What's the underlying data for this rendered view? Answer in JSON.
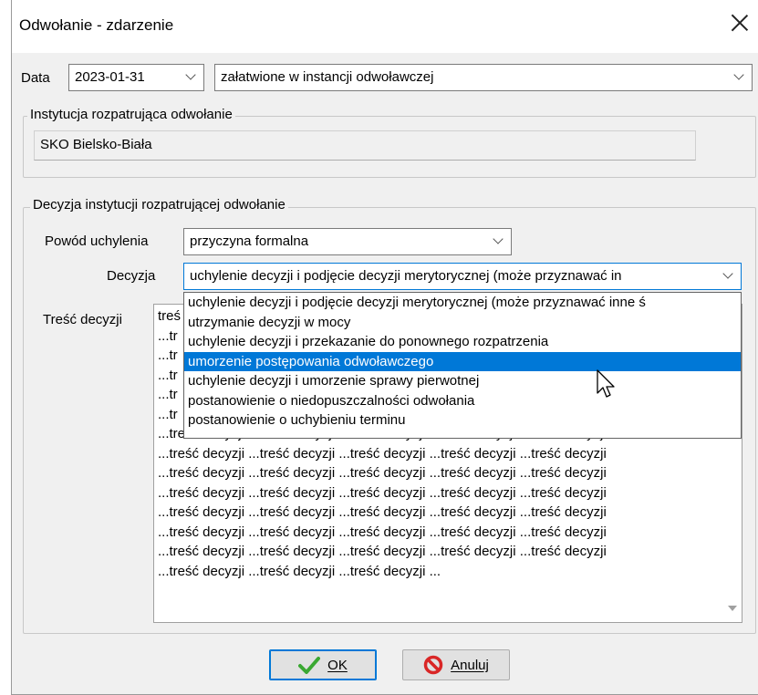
{
  "window": {
    "title": "Odwołanie - zdarzenie"
  },
  "data_row": {
    "label": "Data",
    "date_value": "2023-01-31",
    "status_value": "załatwione w instancji odwoławczej"
  },
  "institution": {
    "legend": "Instytucja rozpatrująca odwołanie",
    "value": "SKO Bielsko-Biała"
  },
  "decision_group": {
    "legend": "Decyzja instytucji rozpatrującej odwołanie",
    "reason_label": "Powód uchylenia",
    "reason_value": "przyczyna formalna",
    "decision_label": "Decyzja",
    "decision_value": "uchylenie decyzji i podjęcie decyzji merytorycznej (może przyznawać in",
    "content_label": "Treść decyzji",
    "content_lines": [
      "treś",
      "...tr",
      "...tr",
      "...tr",
      "...tr",
      "...tr",
      "...treść decyzji ...treść decyzji ...treść decyzji ...treść decyzji ...treść decyzji",
      "...treść decyzji ...treść decyzji ...treść decyzji ...treść decyzji ...treść decyzji",
      "...treść decyzji ...treść decyzji ...treść decyzji ...treść decyzji ...treść decyzji",
      "...treść decyzji ...treść decyzji ...treść decyzji ...treść decyzji ...treść decyzji",
      "...treść decyzji ...treść decyzji ...treść decyzji ...treść decyzji ...treść decyzji",
      "...treść decyzji ...treść decyzji ...treść decyzji ...treść decyzji ...treść decyzji",
      "...treść decyzji ...treść decyzji ...treść decyzji ...treść decyzji ...treść decyzji",
      "...treść decyzji ...treść decyzji ...treść decyzji ..."
    ]
  },
  "decision_dropdown": {
    "options": [
      "uchylenie decyzji i podjęcie decyzji merytorycznej (może przyznawać inne ś",
      "utrzymanie decyzji w mocy",
      "uchylenie decyzji i przekazanie do ponownego rozpatrzenia",
      "umorzenie postępowania odwoławczego",
      "uchylenie decyzji i umorzenie sprawy pierwotnej",
      "postanowienie o niedopuszczalności odwołania",
      "postanowienie o uchybieniu terminu"
    ],
    "highlighted_index": 3
  },
  "buttons": {
    "ok_label": "OK",
    "cancel_label": "Anuluj"
  },
  "colors": {
    "selection": "#0078d7",
    "ok_check": "#3aa832",
    "cancel_icon": "#d92626"
  }
}
